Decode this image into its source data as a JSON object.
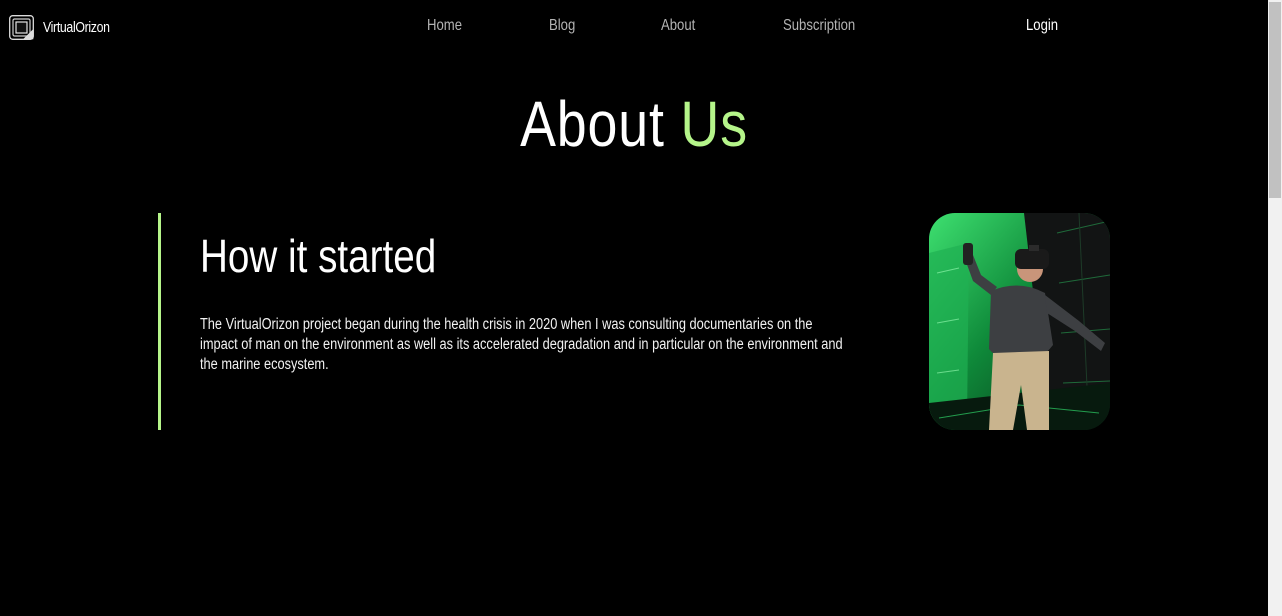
{
  "header": {
    "brand_name": "VirtualOrizon",
    "nav": {
      "home": "Home",
      "blog": "Blog",
      "about": "About",
      "subscription": "Subscription"
    },
    "login": "Login"
  },
  "page": {
    "title_main": "About",
    "title_accent": "Us"
  },
  "section": {
    "heading": "How it started",
    "body": "The VirtualOrizon project began during the health crisis in 2020 when I was consulting documentaries on the impact of man on the environment as well as its accelerated degradation and in particular on the environment and the marine ecosystem."
  },
  "colors": {
    "background": "#000000",
    "accent": "#b5f58a",
    "nav_text": "#b4b4b4",
    "text": "#ffffff"
  },
  "icons": {
    "brand": "square-frame-logo-icon"
  }
}
